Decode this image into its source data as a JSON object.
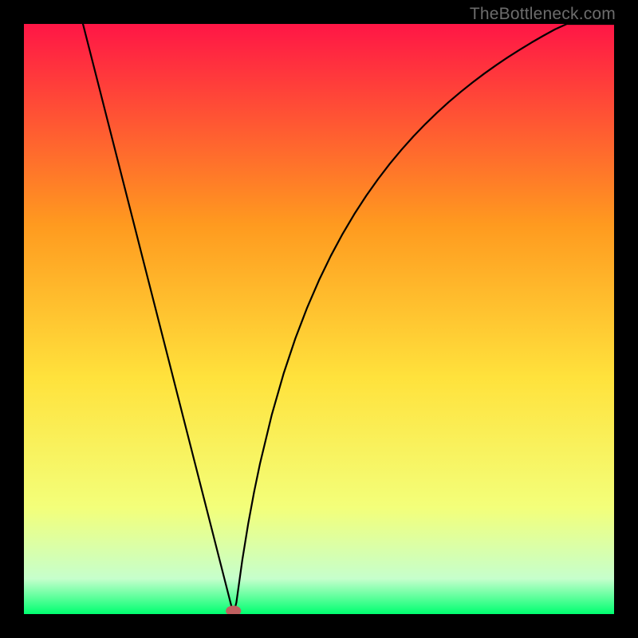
{
  "watermark": "TheBottleneck.com",
  "chart_data": {
    "type": "line",
    "title": "",
    "xlabel": "",
    "ylabel": "",
    "xlim": [
      0,
      100
    ],
    "ylim": [
      0,
      100
    ],
    "background_gradient": {
      "top_color": "#ff1646",
      "top_mid_color": "#ff9a1f",
      "mid_color": "#ffe23c",
      "low_mid_color": "#f3ff7a",
      "near_bottom_color": "#c6ffcc",
      "bottom_color": "#00ff70"
    },
    "minimum_marker": {
      "x": 35.5,
      "y": 0,
      "color": "#c06060",
      "rx": 1.3,
      "ry": 0.9
    },
    "curve_notes": "V-shaped bottleneck curve: steep descent from top-left to minimum near x≈35, then concave rise to right edge at y≈82.",
    "series": [
      {
        "name": "bottleneck-curve",
        "color": "#000000",
        "stroke_width": 2.2,
        "x": [
          10,
          11,
          12,
          13,
          14,
          15,
          16,
          17,
          18,
          19,
          20,
          21,
          22,
          23,
          24,
          25,
          26,
          27,
          28,
          29,
          30,
          31,
          32,
          33,
          34,
          35,
          35.5,
          36,
          37,
          38,
          39,
          40,
          42,
          44,
          46,
          48,
          50,
          52,
          54,
          56,
          58,
          60,
          62,
          64,
          66,
          68,
          70,
          72,
          74,
          76,
          78,
          80,
          82,
          84,
          86,
          88,
          90,
          92,
          94,
          96,
          98,
          100
        ],
        "y": [
          100,
          96.08,
          92.16,
          88.24,
          84.31,
          80.39,
          76.47,
          72.55,
          68.63,
          64.71,
          60.78,
          56.86,
          52.94,
          49.02,
          45.1,
          41.18,
          37.25,
          33.33,
          29.41,
          25.49,
          21.57,
          17.65,
          13.73,
          9.8,
          5.88,
          1.96,
          0,
          1.96,
          9.13,
          15.29,
          20.68,
          25.49,
          33.78,
          40.74,
          46.72,
          51.94,
          56.57,
          60.7,
          64.42,
          67.8,
          70.88,
          73.7,
          76.31,
          78.71,
          80.95,
          83.02,
          84.96,
          86.78,
          88.47,
          90.07,
          91.58,
          93.0,
          94.35,
          95.62,
          96.84,
          97.99,
          99.09,
          100,
          100,
          100,
          100,
          100
        ]
      }
    ]
  }
}
